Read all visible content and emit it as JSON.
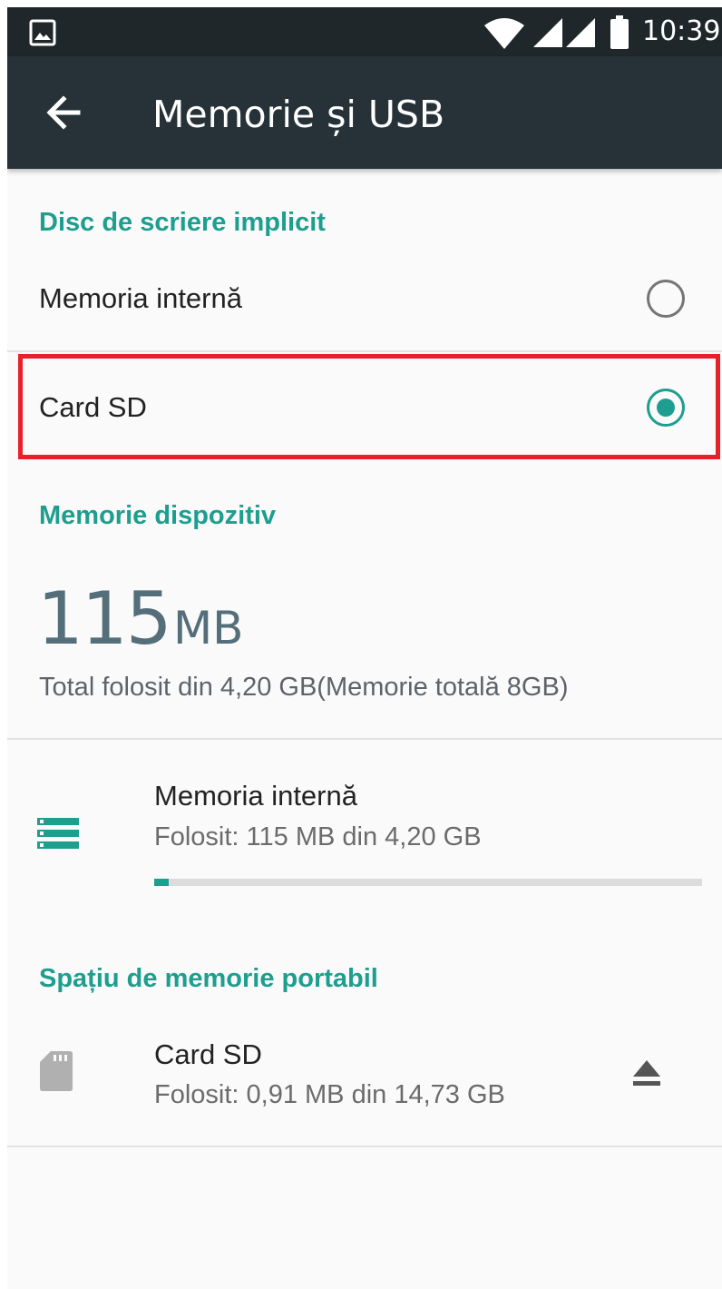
{
  "status_bar": {
    "time": "10:39",
    "icons": [
      "gallery-notification-icon",
      "wifi-icon",
      "signal-icon",
      "signal-icon",
      "battery-icon"
    ]
  },
  "toolbar": {
    "title": "Memorie și USB",
    "back_icon": "arrow-back-icon"
  },
  "default_write_disk": {
    "header": "Disc de scriere implicit",
    "options": [
      {
        "label": "Memoria internă",
        "selected": false
      },
      {
        "label": "Card SD",
        "selected": true
      }
    ]
  },
  "device_storage": {
    "header": "Memorie dispozitiv",
    "used_value": "115",
    "used_unit": "MB",
    "summary": "Total folosit din 4,20 GB(Memorie totală 8GB)",
    "internal": {
      "icon": "storage-icon",
      "title": "Memoria internă",
      "subtitle": "Folosit: 115 MB din 4,20 GB",
      "used_fraction": 0.027
    }
  },
  "portable_storage": {
    "header": "Spațiu de memorie portabil",
    "sd_card": {
      "icon": "sd-card-icon",
      "title": "Card SD",
      "subtitle": "Folosit: 0,91 MB din 14,73 GB",
      "action_icon": "eject-icon"
    }
  },
  "colors": {
    "accent": "#1e9e8f",
    "toolbar": "#263238",
    "status_bar": "#1f272b",
    "highlight_box": "#e8202a"
  }
}
